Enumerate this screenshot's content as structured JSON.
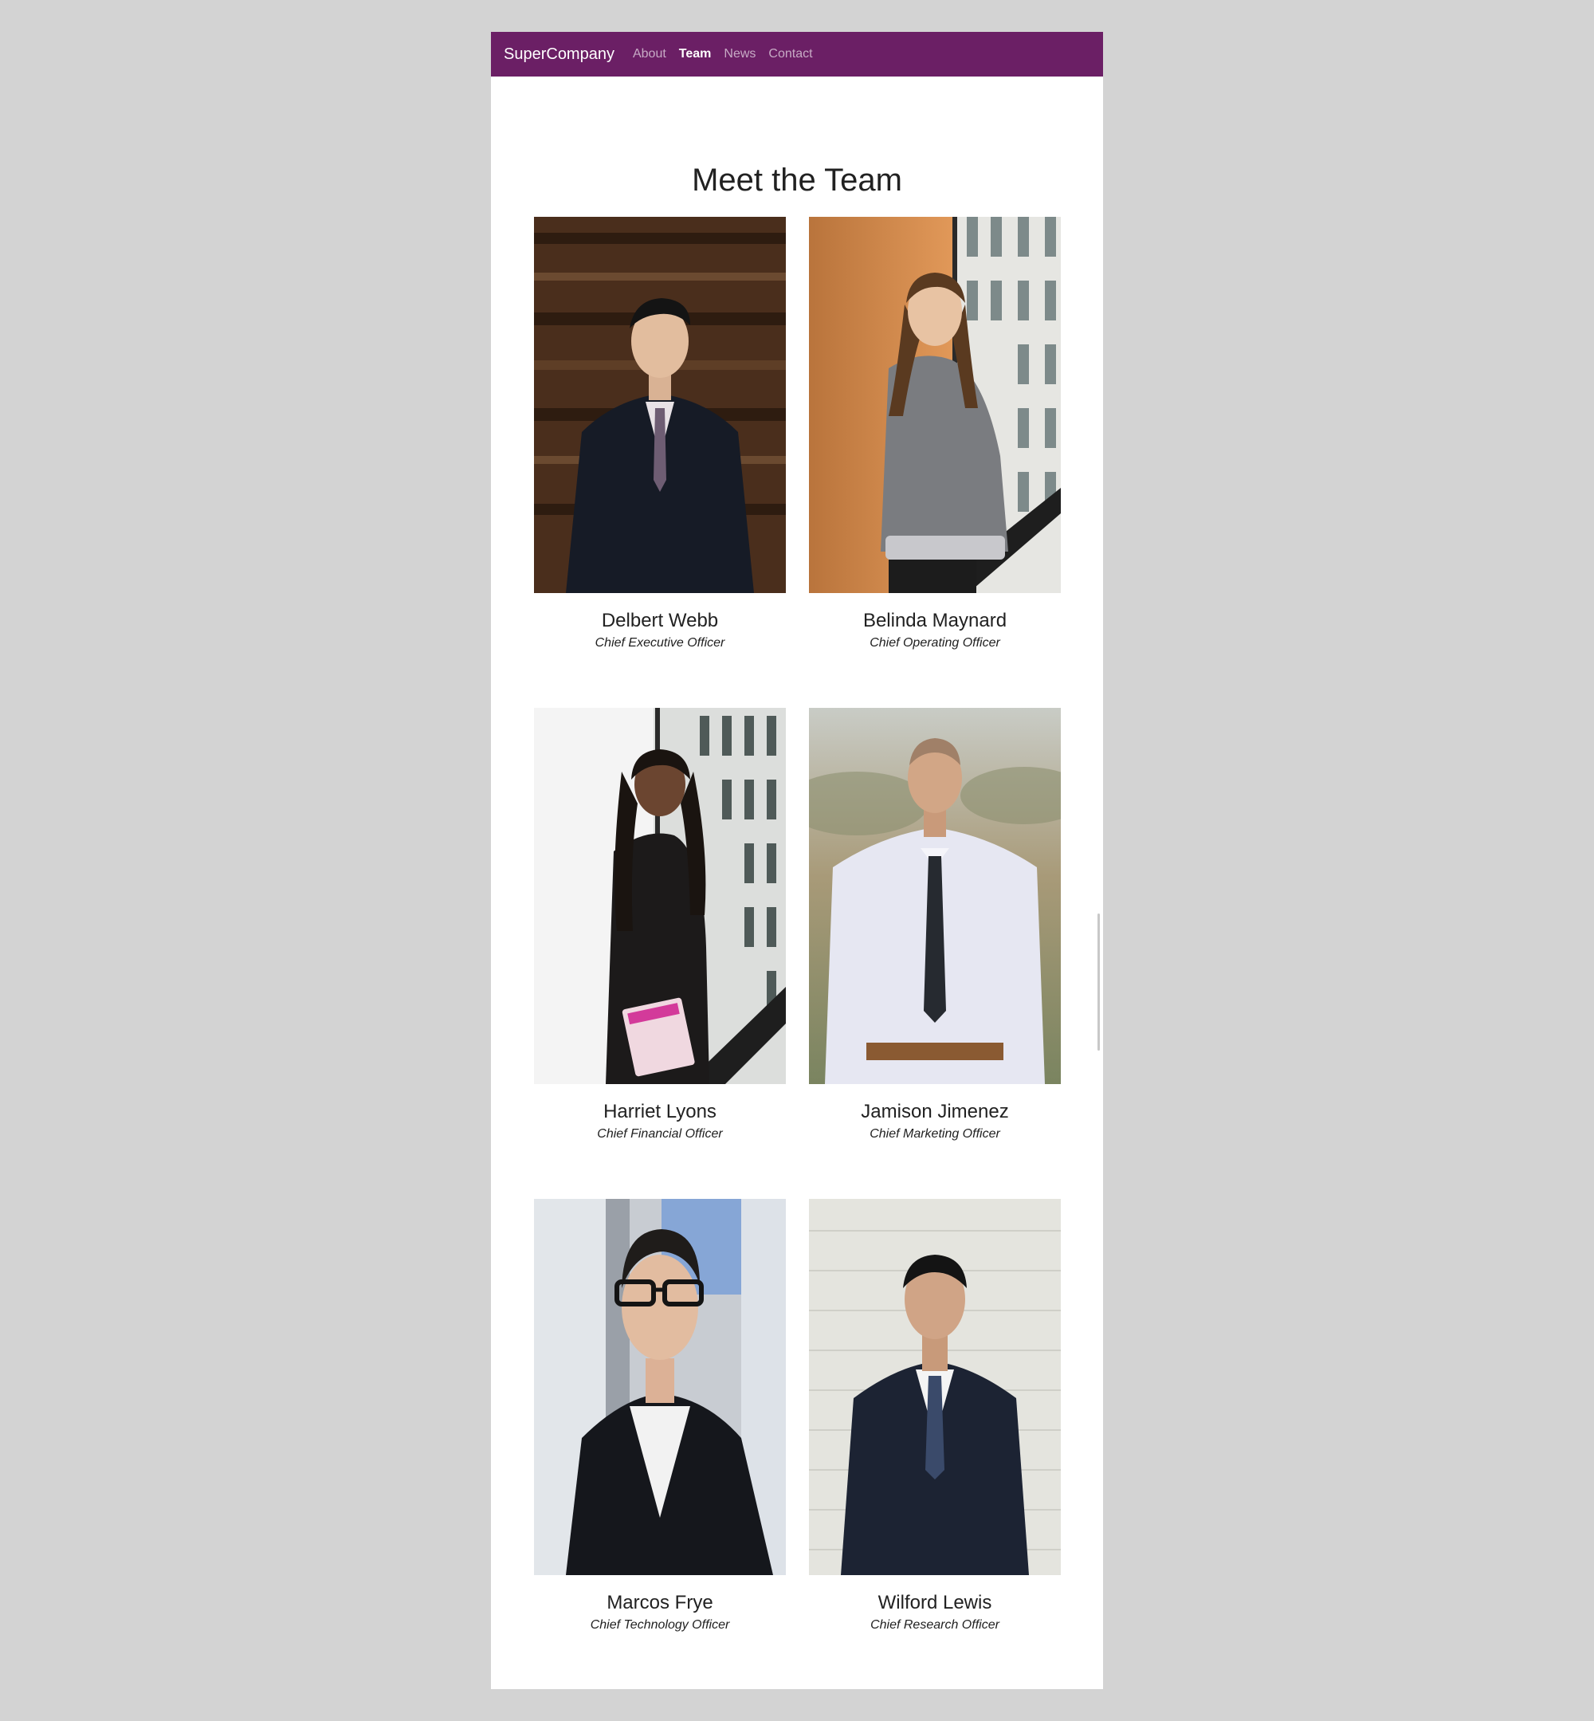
{
  "navbar": {
    "brand": "SuperCompany",
    "links": [
      {
        "label": "About",
        "active": false
      },
      {
        "label": "Team",
        "active": true
      },
      {
        "label": "News",
        "active": false
      },
      {
        "label": "Contact",
        "active": false
      }
    ]
  },
  "page_title": "Meet the Team",
  "team": [
    {
      "name": "Delbert Webb",
      "role": "Chief Executive Officer"
    },
    {
      "name": "Belinda Maynard",
      "role": "Chief Operating Officer"
    },
    {
      "name": "Harriet Lyons",
      "role": "Chief Financial Officer"
    },
    {
      "name": "Jamison Jimenez",
      "role": "Chief Marketing Officer"
    },
    {
      "name": "Marcos Frye",
      "role": "Chief Technology Officer"
    },
    {
      "name": "Wilford Lewis",
      "role": "Chief Research Officer"
    }
  ],
  "colors": {
    "navbar": "#6b1f65",
    "page_background": "#d3d3d3",
    "content_background": "#ffffff"
  }
}
